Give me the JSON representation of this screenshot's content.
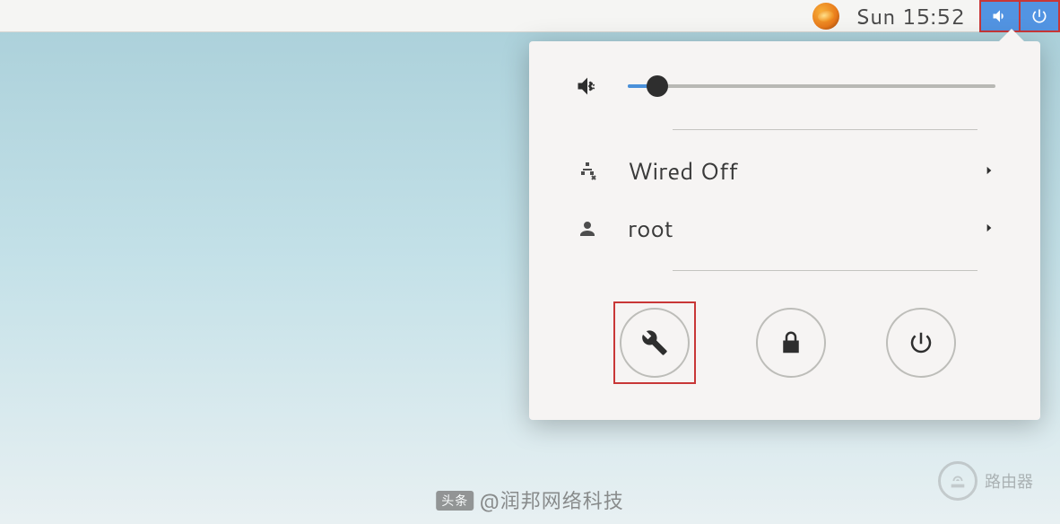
{
  "topbar": {
    "clock": "Sun 15:52"
  },
  "menu": {
    "volume_percent": 8,
    "items": [
      {
        "icon": "network-wired-off-icon",
        "label": "Wired Off"
      },
      {
        "icon": "user-icon",
        "label": "root"
      }
    ]
  },
  "actions": {
    "settings": "settings-icon",
    "lock": "lock-icon",
    "power": "power-icon"
  },
  "watermark": {
    "badge": "头条",
    "text": "@润邦网络科技"
  },
  "corner_logo": {
    "text": "路由器"
  }
}
